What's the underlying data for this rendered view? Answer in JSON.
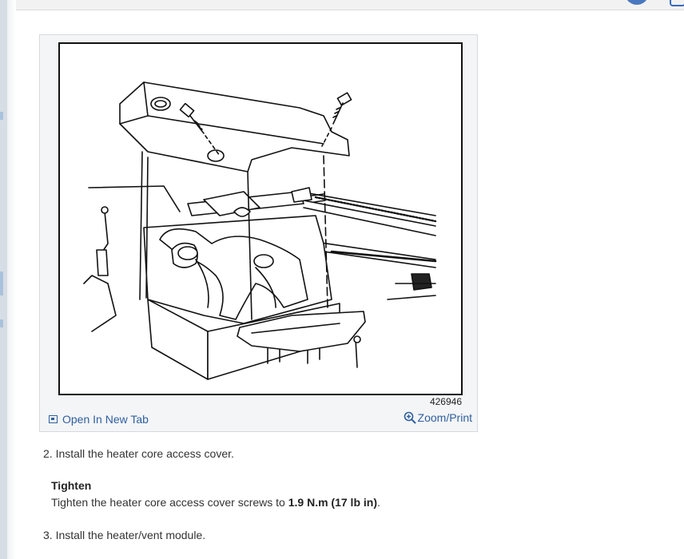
{
  "figure": {
    "number": "426946",
    "open_label": "Open In New Tab",
    "zoom_label": "Zoom/Print"
  },
  "steps": {
    "step2": "2. Install the heater core access cover.",
    "note_title": "Tighten",
    "note_prefix": "Tighten the heater core access cover screws to ",
    "note_value": "1.9 N.m (17 lb in)",
    "note_suffix": ".",
    "step3": "3. Install the heater/vent module."
  },
  "colors": {
    "link": "#2f5f9e",
    "text": "#333333"
  }
}
